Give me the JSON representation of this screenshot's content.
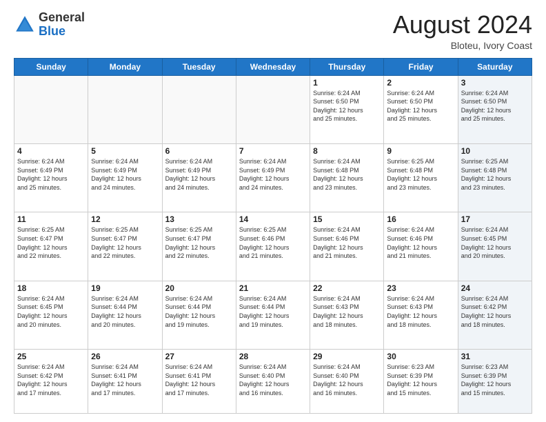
{
  "logo": {
    "general": "General",
    "blue": "Blue"
  },
  "header": {
    "month": "August 2024",
    "location": "Bloteu, Ivory Coast"
  },
  "days_of_week": [
    "Sunday",
    "Monday",
    "Tuesday",
    "Wednesday",
    "Thursday",
    "Friday",
    "Saturday"
  ],
  "weeks": [
    [
      {
        "day": "",
        "info": ""
      },
      {
        "day": "",
        "info": ""
      },
      {
        "day": "",
        "info": ""
      },
      {
        "day": "",
        "info": ""
      },
      {
        "day": "1",
        "info": "Sunrise: 6:24 AM\nSunset: 6:50 PM\nDaylight: 12 hours\nand 25 minutes."
      },
      {
        "day": "2",
        "info": "Sunrise: 6:24 AM\nSunset: 6:50 PM\nDaylight: 12 hours\nand 25 minutes."
      },
      {
        "day": "3",
        "info": "Sunrise: 6:24 AM\nSunset: 6:50 PM\nDaylight: 12 hours\nand 25 minutes."
      }
    ],
    [
      {
        "day": "4",
        "info": "Sunrise: 6:24 AM\nSunset: 6:49 PM\nDaylight: 12 hours\nand 25 minutes."
      },
      {
        "day": "5",
        "info": "Sunrise: 6:24 AM\nSunset: 6:49 PM\nDaylight: 12 hours\nand 24 minutes."
      },
      {
        "day": "6",
        "info": "Sunrise: 6:24 AM\nSunset: 6:49 PM\nDaylight: 12 hours\nand 24 minutes."
      },
      {
        "day": "7",
        "info": "Sunrise: 6:24 AM\nSunset: 6:49 PM\nDaylight: 12 hours\nand 24 minutes."
      },
      {
        "day": "8",
        "info": "Sunrise: 6:24 AM\nSunset: 6:48 PM\nDaylight: 12 hours\nand 23 minutes."
      },
      {
        "day": "9",
        "info": "Sunrise: 6:25 AM\nSunset: 6:48 PM\nDaylight: 12 hours\nand 23 minutes."
      },
      {
        "day": "10",
        "info": "Sunrise: 6:25 AM\nSunset: 6:48 PM\nDaylight: 12 hours\nand 23 minutes."
      }
    ],
    [
      {
        "day": "11",
        "info": "Sunrise: 6:25 AM\nSunset: 6:47 PM\nDaylight: 12 hours\nand 22 minutes."
      },
      {
        "day": "12",
        "info": "Sunrise: 6:25 AM\nSunset: 6:47 PM\nDaylight: 12 hours\nand 22 minutes."
      },
      {
        "day": "13",
        "info": "Sunrise: 6:25 AM\nSunset: 6:47 PM\nDaylight: 12 hours\nand 22 minutes."
      },
      {
        "day": "14",
        "info": "Sunrise: 6:25 AM\nSunset: 6:46 PM\nDaylight: 12 hours\nand 21 minutes."
      },
      {
        "day": "15",
        "info": "Sunrise: 6:24 AM\nSunset: 6:46 PM\nDaylight: 12 hours\nand 21 minutes."
      },
      {
        "day": "16",
        "info": "Sunrise: 6:24 AM\nSunset: 6:46 PM\nDaylight: 12 hours\nand 21 minutes."
      },
      {
        "day": "17",
        "info": "Sunrise: 6:24 AM\nSunset: 6:45 PM\nDaylight: 12 hours\nand 20 minutes."
      }
    ],
    [
      {
        "day": "18",
        "info": "Sunrise: 6:24 AM\nSunset: 6:45 PM\nDaylight: 12 hours\nand 20 minutes."
      },
      {
        "day": "19",
        "info": "Sunrise: 6:24 AM\nSunset: 6:44 PM\nDaylight: 12 hours\nand 20 minutes."
      },
      {
        "day": "20",
        "info": "Sunrise: 6:24 AM\nSunset: 6:44 PM\nDaylight: 12 hours\nand 19 minutes."
      },
      {
        "day": "21",
        "info": "Sunrise: 6:24 AM\nSunset: 6:44 PM\nDaylight: 12 hours\nand 19 minutes."
      },
      {
        "day": "22",
        "info": "Sunrise: 6:24 AM\nSunset: 6:43 PM\nDaylight: 12 hours\nand 18 minutes."
      },
      {
        "day": "23",
        "info": "Sunrise: 6:24 AM\nSunset: 6:43 PM\nDaylight: 12 hours\nand 18 minutes."
      },
      {
        "day": "24",
        "info": "Sunrise: 6:24 AM\nSunset: 6:42 PM\nDaylight: 12 hours\nand 18 minutes."
      }
    ],
    [
      {
        "day": "25",
        "info": "Sunrise: 6:24 AM\nSunset: 6:42 PM\nDaylight: 12 hours\nand 17 minutes."
      },
      {
        "day": "26",
        "info": "Sunrise: 6:24 AM\nSunset: 6:41 PM\nDaylight: 12 hours\nand 17 minutes."
      },
      {
        "day": "27",
        "info": "Sunrise: 6:24 AM\nSunset: 6:41 PM\nDaylight: 12 hours\nand 17 minutes."
      },
      {
        "day": "28",
        "info": "Sunrise: 6:24 AM\nSunset: 6:40 PM\nDaylight: 12 hours\nand 16 minutes."
      },
      {
        "day": "29",
        "info": "Sunrise: 6:24 AM\nSunset: 6:40 PM\nDaylight: 12 hours\nand 16 minutes."
      },
      {
        "day": "30",
        "info": "Sunrise: 6:23 AM\nSunset: 6:39 PM\nDaylight: 12 hours\nand 15 minutes."
      },
      {
        "day": "31",
        "info": "Sunrise: 6:23 AM\nSunset: 6:39 PM\nDaylight: 12 hours\nand 15 minutes."
      }
    ]
  ]
}
